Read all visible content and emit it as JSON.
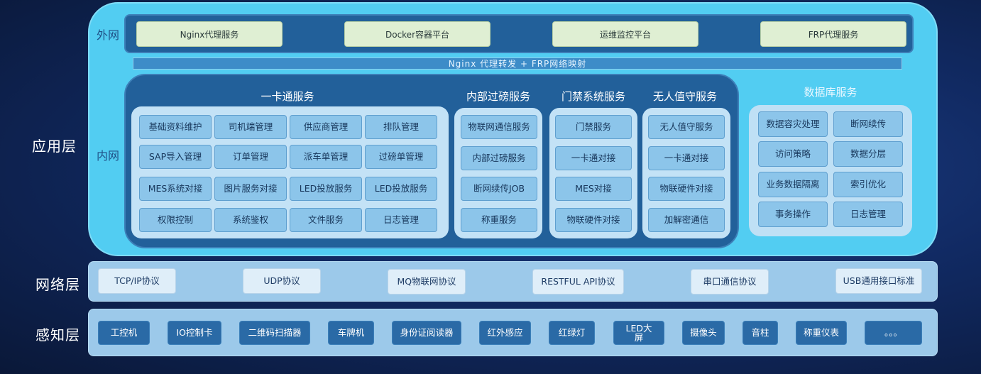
{
  "layers": {
    "application": "应用层",
    "network": "网络层",
    "perception": "感知层"
  },
  "zones": {
    "external": "外网",
    "internal": "内网"
  },
  "external_services": [
    "Nginx代理服务",
    "Docker容器平台",
    "运维监控平台",
    "FRP代理服务"
  ],
  "proxy_bar": "Nginx 代理转发 + FRP网络映射",
  "one_card": {
    "title": "一卡通服务",
    "cells": [
      "基础资料维护",
      "司机端管理",
      "供应商管理",
      "排队管理",
      "SAP导入管理",
      "订单管理",
      "派车单管理",
      "过磅单管理",
      "MES系统对接",
      "图片服务对接",
      "LED投放服务",
      "LED投放服务",
      "权限控制",
      "系统鉴权",
      "文件服务",
      "日志管理"
    ]
  },
  "weighing": {
    "title": "内部过磅服务",
    "cells": [
      "物联网通信服务",
      "内部过磅服务",
      "断网续传JOB",
      "称重服务"
    ]
  },
  "access": {
    "title": "门禁系统服务",
    "cells": [
      "门禁服务",
      "一卡通对接",
      "MES对接",
      "物联硬件对接"
    ]
  },
  "unattended": {
    "title": "无人值守服务",
    "cells": [
      "无人值守服务",
      "一卡通对接",
      "物联硬件对接",
      "加解密通信"
    ]
  },
  "database": {
    "title": "数据库服务",
    "cells": [
      "数据容灾处理",
      "断网续传",
      "访问策略",
      "数据分层",
      "业务数据隔离",
      "索引优化",
      "事务操作",
      "日志管理"
    ]
  },
  "network_protocols": [
    "TCP/IP协议",
    "UDP协议",
    "MQ物联网协议",
    "RESTFUL  API协议",
    "串口通信协议",
    "USB通用接口标准"
  ],
  "perception_devices": [
    "工控机",
    "IO控制卡",
    "二维码扫描器",
    "车牌机",
    "身份证阅读器",
    "红外感应",
    "红绿灯",
    "LED大屏",
    "摄像头",
    "音柱",
    "称重仪表",
    "。。。"
  ],
  "colors": {
    "app_outer": "#52cdf2",
    "panel_dark": "#22609a",
    "cell_blue": "#8cc5ea",
    "group_light": "#c3e2f6",
    "external_btn": "#dfefd3",
    "band": "#9cc9ea",
    "device": "#2a6aa6"
  }
}
